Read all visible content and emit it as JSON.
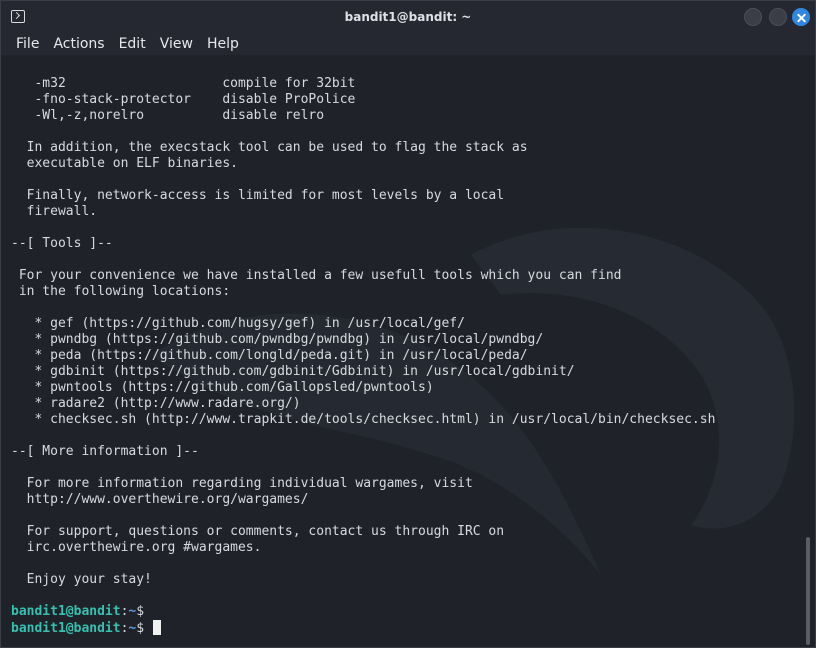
{
  "window": {
    "title": "bandit1@bandit: ~"
  },
  "menu": [
    "File",
    "Actions",
    "Edit",
    "View",
    "Help"
  ],
  "terminal_lines": [
    "   -m32                    compile for 32bit",
    "   -fno-stack-protector    disable ProPolice",
    "   -Wl,-z,norelro          disable relro",
    "",
    "  In addition, the execstack tool can be used to flag the stack as",
    "  executable on ELF binaries.",
    "",
    "  Finally, network-access is limited for most levels by a local",
    "  firewall.",
    "",
    "--[ Tools ]--",
    "",
    " For your convenience we have installed a few usefull tools which you can find",
    " in the following locations:",
    "",
    "   * gef (https://github.com/hugsy/gef) in /usr/local/gef/",
    "   * pwndbg (https://github.com/pwndbg/pwndbg) in /usr/local/pwndbg/",
    "   * peda (https://github.com/longld/peda.git) in /usr/local/peda/",
    "   * gdbinit (https://github.com/gdbinit/Gdbinit) in /usr/local/gdbinit/",
    "   * pwntools (https://github.com/Gallopsled/pwntools)",
    "   * radare2 (http://www.radare.org/)",
    "   * checksec.sh (http://www.trapkit.de/tools/checksec.html) in /usr/local/bin/checksec.sh",
    "",
    "--[ More information ]--",
    "",
    "  For more information regarding individual wargames, visit",
    "  http://www.overthewire.org/wargames/",
    "",
    "  For support, questions or comments, contact us through IRC on",
    "  irc.overthewire.org #wargames.",
    "",
    "  Enjoy your stay!",
    ""
  ],
  "prompts": [
    {
      "user": "bandit1@bandit",
      "sep": ":",
      "path": "~",
      "symbol": "$"
    },
    {
      "user": "bandit1@bandit",
      "sep": ":",
      "path": "~",
      "symbol": "$"
    }
  ]
}
